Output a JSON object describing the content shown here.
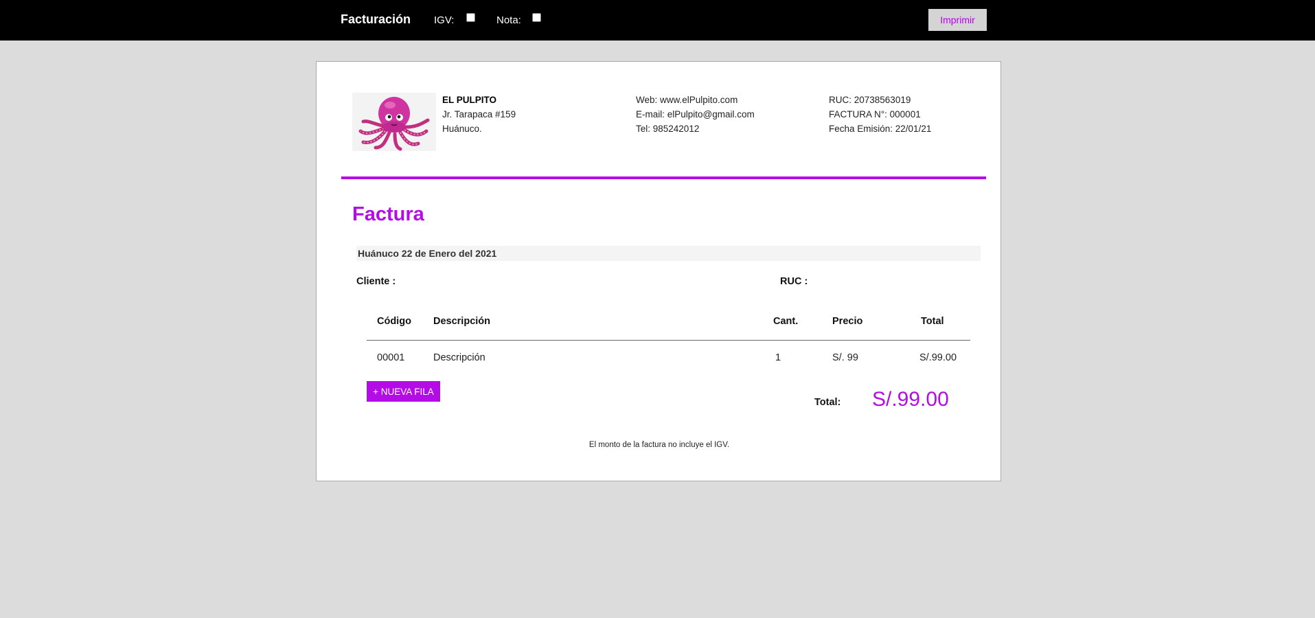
{
  "topbar": {
    "title": "Facturación",
    "igv_label": "IGV:",
    "igv_checked": false,
    "nota_label": "Nota:",
    "nota_checked": false,
    "print_label": "Imprimir"
  },
  "company": {
    "name": "EL PULPITO",
    "address": "Jr. Tarapaca #159",
    "city": "Huánuco.",
    "web": "Web: www.elPulpito.com",
    "email": "E-mail: elPulpito@gmail.com",
    "tel": "Tel: 985242012",
    "ruc": "RUC: 20738563019",
    "invoice_no": "FACTURA N°: 000001",
    "issue_date": "Fecha Emisión: 22/01/21"
  },
  "invoice": {
    "title": "Factura",
    "date_line": "Huánuco 22 de Enero del 2021",
    "client_label": "Cliente :",
    "ruc_label": "RUC :",
    "columns": [
      "Código",
      "Descripción",
      "Cant.",
      "Precio",
      "Total"
    ],
    "rows": [
      {
        "code": "00001",
        "description": "Descripción",
        "qty": "1",
        "price": "S/. 99",
        "total": "S/.99.00"
      }
    ],
    "add_row_label": "+ NUEVA FILA",
    "total_label": "Total:",
    "total_value": "S/.99.00",
    "note": "El monto de la factura no incluye el IGV."
  },
  "colors": {
    "accent": "#b40ce6",
    "topbar": "#000000",
    "background": "#dcdcdc"
  },
  "icons": {
    "logo": "octopus-logo"
  }
}
